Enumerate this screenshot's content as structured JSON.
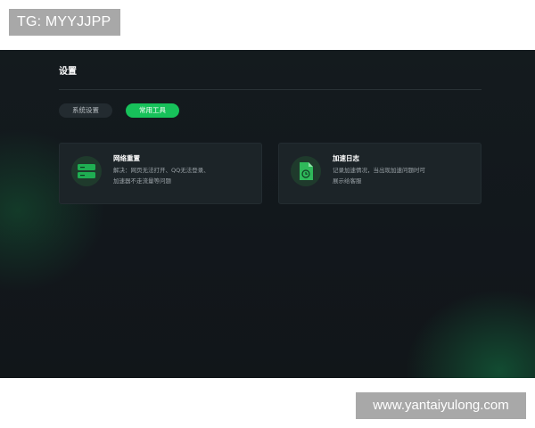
{
  "watermarks": {
    "top": "TG: MYYJJPP",
    "bottom": "www.yantaiyulong.com"
  },
  "header": {
    "title": "设置"
  },
  "tabs": [
    {
      "label": "系统设置",
      "active": false
    },
    {
      "label": "常用工具",
      "active": true
    }
  ],
  "tools": [
    {
      "title": "网络重置",
      "description": "解决：网页无法打开、QQ无法登录、加速器不走流量等问题",
      "icon": "server-icon"
    },
    {
      "title": "加速日志",
      "description": "记录加速情况，当出现加速问题时可展示给客服",
      "icon": "document-icon"
    }
  ],
  "colors": {
    "accent": "#17c15a",
    "background": "#12171c",
    "card": "#1c2428"
  }
}
